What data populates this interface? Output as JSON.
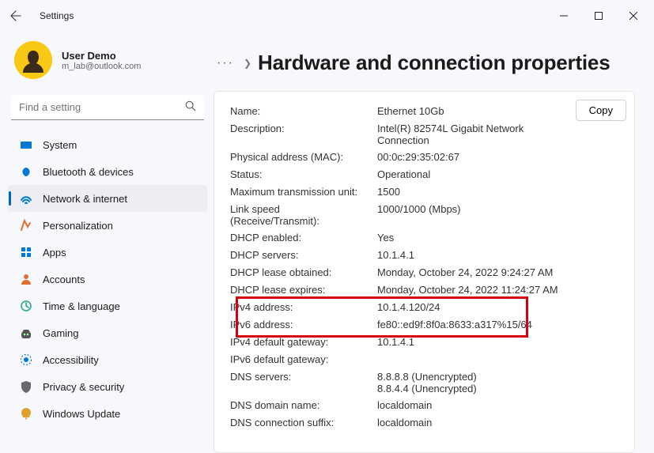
{
  "window": {
    "title": "Settings"
  },
  "user": {
    "name": "User Demo",
    "email": "m_lab@outlook.com"
  },
  "search": {
    "placeholder": "Find a setting"
  },
  "sidebar": {
    "items": [
      {
        "label": "System"
      },
      {
        "label": "Bluetooth & devices"
      },
      {
        "label": "Network & internet"
      },
      {
        "label": "Personalization"
      },
      {
        "label": "Apps"
      },
      {
        "label": "Accounts"
      },
      {
        "label": "Time & language"
      },
      {
        "label": "Gaming"
      },
      {
        "label": "Accessibility"
      },
      {
        "label": "Privacy & security"
      },
      {
        "label": "Windows Update"
      }
    ],
    "activeIndex": 2
  },
  "breadcrumb": {
    "ellipsis": "···",
    "title": "Hardware and connection properties"
  },
  "copyLabel": "Copy",
  "properties": [
    {
      "key": "Name:",
      "value": "Ethernet 10Gb"
    },
    {
      "key": "Description:",
      "value": "Intel(R) 82574L Gigabit Network Connection"
    },
    {
      "key": "Physical address (MAC):",
      "value": "00:0c:29:35:02:67"
    },
    {
      "key": "Status:",
      "value": "Operational"
    },
    {
      "key": "Maximum transmission unit:",
      "value": "1500"
    },
    {
      "key": "Link speed (Receive/Transmit):",
      "value": "1000/1000 (Mbps)"
    },
    {
      "key": "DHCP enabled:",
      "value": "Yes"
    },
    {
      "key": "DHCP servers:",
      "value": "10.1.4.1"
    },
    {
      "key": "DHCP lease obtained:",
      "value": "Monday, October 24, 2022 9:24:27 AM"
    },
    {
      "key": "DHCP lease expires:",
      "value": "Monday, October 24, 2022 11:24:27 AM"
    },
    {
      "key": "IPv4 address:",
      "value": "10.1.4.120/24"
    },
    {
      "key": "IPv6 address:",
      "value": "fe80::ed9f:8f0a:8633:a317%15/64"
    },
    {
      "key": "IPv4 default gateway:",
      "value": "10.1.4.1"
    },
    {
      "key": "IPv6 default gateway:",
      "value": ""
    },
    {
      "key": "DNS servers:",
      "value": "8.8.8.8 (Unencrypted)\n8.8.4.4 (Unencrypted)"
    },
    {
      "key": "DNS domain name:",
      "value": "localdomain"
    },
    {
      "key": "DNS connection suffix:",
      "value": "localdomain"
    }
  ]
}
